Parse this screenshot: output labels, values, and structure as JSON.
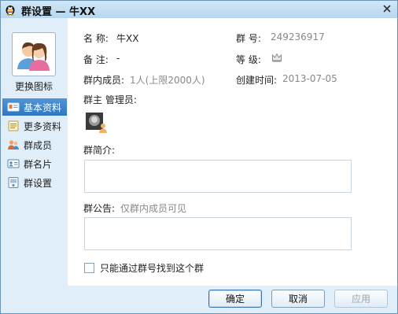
{
  "window": {
    "title": "群设置 — 牛XX"
  },
  "sidebar": {
    "change_icon_label": "更换图标",
    "items": [
      {
        "label": "基本资料",
        "icon": "profile-card-icon",
        "active": true
      },
      {
        "label": "更多资料",
        "icon": "more-info-icon",
        "active": false
      },
      {
        "label": "群成员",
        "icon": "members-icon",
        "active": false
      },
      {
        "label": "群名片",
        "icon": "name-card-icon",
        "active": false
      },
      {
        "label": "群设置",
        "icon": "settings-icon",
        "active": false
      }
    ]
  },
  "info": {
    "name_label": "名  称:",
    "name_value": "牛XX",
    "number_label": "群  号:",
    "number_value": "249236917",
    "remark_label": "备  注:",
    "remark_value": "-",
    "level_label": "等  级:",
    "level_icon": "crown-icon",
    "members_label": "群内成员:",
    "members_value": "1人(上限2000人)",
    "created_label": "创建时间:",
    "created_value": "2013-07-05",
    "admins_label": "群主 管理员:",
    "intro_label": "群简介:",
    "notice_label": "群公告:",
    "notice_hint": "仅群内成员可见",
    "checkbox_label": "只能通过群号找到这个群"
  },
  "footer": {
    "ok_label": "确定",
    "cancel_label": "取消",
    "apply_label": "应用"
  }
}
